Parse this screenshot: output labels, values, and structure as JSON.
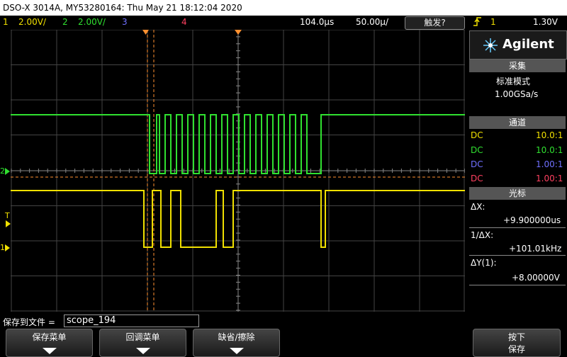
{
  "title": "DSO-X 3014A, MY53280164: Thu May 21 18:12:04 2020",
  "status": {
    "ch1": {
      "num": "1",
      "scale": "2.00V/",
      "color": "#f0e000"
    },
    "ch2": {
      "num": "2",
      "scale": "2.00V/",
      "color": "#30e030"
    },
    "ch3": {
      "num": "3",
      "color": "#7070ff"
    },
    "ch4": {
      "num": "4",
      "color": "#ff4060"
    },
    "timeref": "104.0μs",
    "timescale": "50.00μ/",
    "acquire_button": "触发?",
    "trigger_icon": "trigger-rising-edge-icon",
    "trigger_source": "1",
    "trigger_level": "1.30V"
  },
  "panel": {
    "brand": "Agilent",
    "acq_header": "采集",
    "acq_mode": "标准模式",
    "acq_rate": "1.00GSa/s",
    "chan_header": "通道",
    "channels": [
      {
        "coupling": "DC",
        "ratio": "10.0:1",
        "color": "#f0e000"
      },
      {
        "coupling": "DC",
        "ratio": "10.0:1",
        "color": "#30e030"
      },
      {
        "coupling": "DC",
        "ratio": "1.00:1",
        "color": "#7070ff"
      },
      {
        "coupling": "DC",
        "ratio": "1.00:1",
        "color": "#ff4060"
      }
    ],
    "cursor_header": "光标",
    "dx_label": "ΔX:",
    "dx_value": "+9.900000us",
    "inv_dx_label": "1/ΔX:",
    "inv_dx_value": "+101.01kHz",
    "dy_label": "ΔY(1):",
    "dy_value": "+8.00000V"
  },
  "markers": {
    "ch2": "2",
    "ch1": "1",
    "trig": "T"
  },
  "save_label": "保存到文件 =",
  "filename": "scope_194",
  "softkeys": [
    {
      "label": "保存菜单"
    },
    {
      "label": "回调菜单"
    },
    {
      "label": "缺省/擦除"
    },
    {
      "label_line1": "按下",
      "label_line2": "保存"
    }
  ]
}
